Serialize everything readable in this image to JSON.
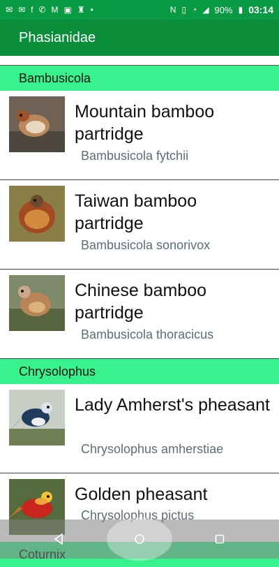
{
  "status_bar": {
    "battery_percent": "90%",
    "time": "03:14",
    "icons_left": [
      "mail-icon",
      "mail-icon",
      "facebook-icon",
      "missed-call-icon",
      "gmail-icon",
      "image-icon",
      "keyhole-icon",
      "dot-icon"
    ],
    "icons_right": [
      "nfc-icon",
      "vibrate-icon",
      "wifi-icon",
      "signal-icon",
      "battery-icon"
    ]
  },
  "app_bar": {
    "title": "Phasianidae"
  },
  "sections": [
    {
      "title": "Bambusicola",
      "items": [
        {
          "common": "Mountain bamboo partridge",
          "scientific": "Bambusicola fytchii"
        },
        {
          "common": "Taiwan bamboo partridge",
          "scientific": "Bambusicola sonorivox"
        },
        {
          "common": "Chinese bamboo partridge",
          "scientific": "Bambusicola thoracicus"
        }
      ]
    },
    {
      "title": "Chrysolophus",
      "items": [
        {
          "common": "Lady Amherst's pheasant",
          "scientific": "Chrysolophus amherstiae"
        },
        {
          "common": "Golden pheasant",
          "scientific": "Chrysolophus pictus"
        }
      ]
    },
    {
      "title": "Coturnix",
      "items": []
    }
  ],
  "colors": {
    "status": "#0a9a43",
    "app_bar": "#0b8e3a",
    "section": "#38f28d",
    "scientific": "#5b6e7b"
  }
}
